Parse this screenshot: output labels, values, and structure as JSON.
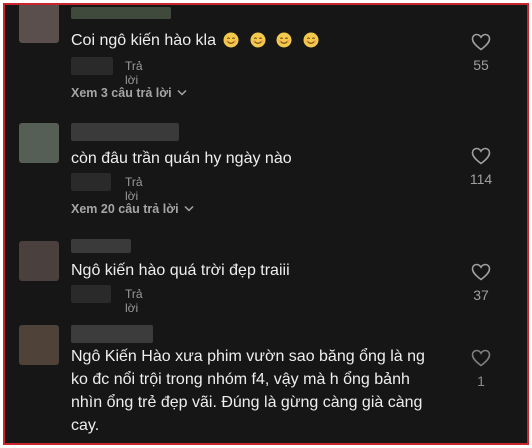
{
  "colors": {
    "background": "#161616",
    "border": "#c9252d",
    "text": "#eeeeee",
    "muted": "#9a9a9a",
    "emoji": "#f2c94c"
  },
  "comments": [
    {
      "text": "Coi ngô kiến hào kla",
      "emoji_count": 4,
      "emoji_icon": "smiling-face-emoji",
      "reply_label": "Trả lời",
      "like_count": "55",
      "view_replies": "Xem 3 câu trả lời",
      "avatar_color": "#5a4f4c",
      "user_color": "#3f4a3c"
    },
    {
      "text": "còn đâu trần quán hy ngày nào",
      "reply_label": "Trả lời",
      "like_count": "114",
      "view_replies": "Xem 20 câu trả lời",
      "avatar_color": "#555f55",
      "user_color": "#3a3a3a"
    },
    {
      "text": "Ngô kiến hào quá trời đẹp traiii",
      "reply_label": "Trả lời",
      "like_count": "37",
      "avatar_color": "#4a403e",
      "user_color": "#3a3a3a"
    },
    {
      "text": "Ngô Kiến Hào xưa phim vườn sao băng ổng là ng ko đc nổi trội trong nhóm f4, vậy mà h ổng bảnh nhìn ổng trẻ đẹp vãi. Đúng là gừng càng già càng cay.",
      "like_count": "1",
      "avatar_color": "#4e4239",
      "user_color": "#3c3c3c"
    }
  ]
}
